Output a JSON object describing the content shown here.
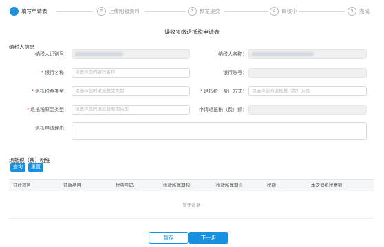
{
  "steps": [
    {
      "num": "1",
      "label": "填写申请表"
    },
    {
      "num": "2",
      "label": "上传附报资料"
    },
    {
      "num": "3",
      "label": "预览提交"
    },
    {
      "num": "4",
      "label": "审核中"
    },
    {
      "num": "5",
      "label": "完成"
    }
  ],
  "form_title": "误收多缴退抵税申请表",
  "taxpayer_section": "纳税人信息",
  "fields": {
    "taxpayer_id_label": "纳税人识别号：",
    "taxpayer_name_label": "纳税人名称：",
    "bank_name_label": "银行名称：",
    "bank_name_placeholder": "请选择您的银行名称",
    "bank_account_label": "银行账号：",
    "refund_type_label": "退抵税金类型：",
    "refund_type_placeholder": "请选择您的退抵税金类型",
    "refund_method_label": "退抵税（费）方式：",
    "refund_method_placeholder": "请选择您的退抵税（费）方式",
    "refund_reason_type_label": "退抵税原因类型：",
    "refund_reason_type_placeholder": "请选择您的退抵税原因类型",
    "refund_amount_label": "申请退抵税（费）额：",
    "refund_reason_label": "退抵申请理由："
  },
  "detail_section": "退抵税（费）明细",
  "buttons": {
    "query": "查询",
    "reset": "重置",
    "save_draft": "暂存",
    "next": "下一步"
  },
  "table": {
    "columns": [
      "征收项目",
      "征收品目",
      "税票号码",
      "税款所属期起",
      "税款所属期止",
      "税额",
      "本次退抵税费额"
    ],
    "empty_text": "暂无数据"
  }
}
